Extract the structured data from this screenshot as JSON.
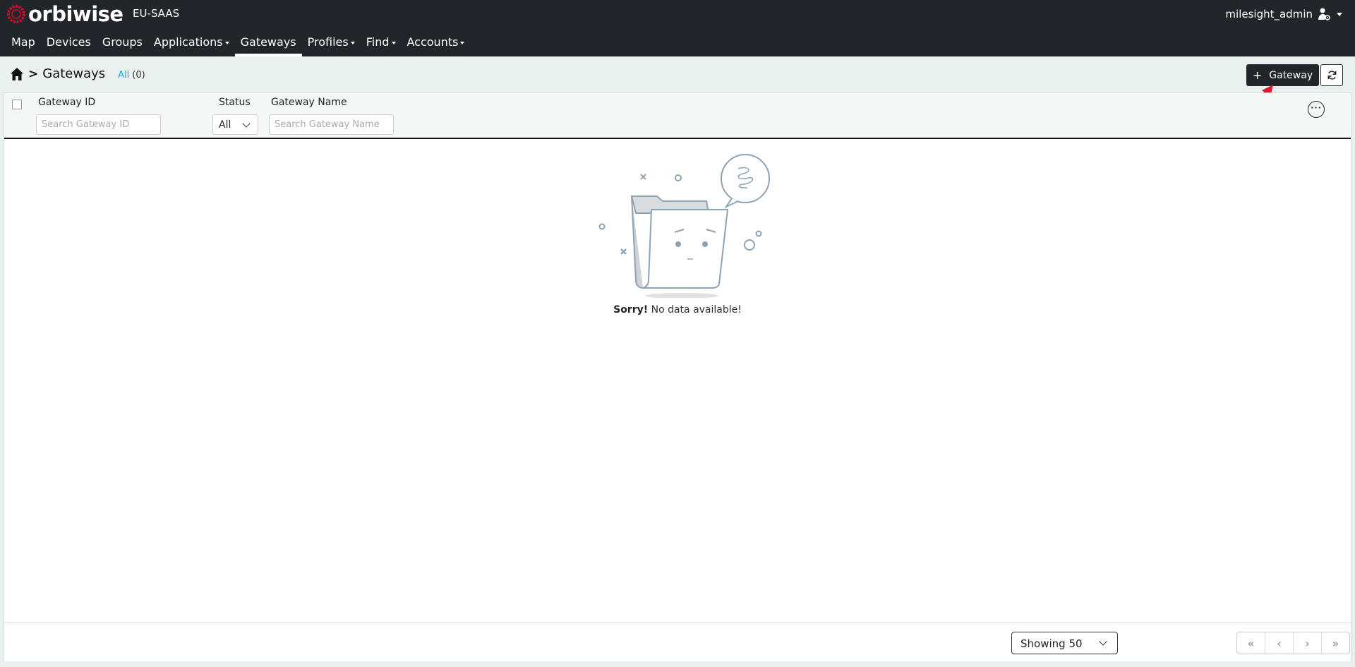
{
  "header": {
    "brand": "orbiwise",
    "environment": "EU-SAAS",
    "username": "milesight_admin",
    "colors": {
      "navbar_bg": "#22252a",
      "brand_accent": "#c8102e",
      "link": "#1aa3d6"
    }
  },
  "menu": [
    {
      "label": "Map",
      "dropdown": false
    },
    {
      "label": "Devices",
      "dropdown": false
    },
    {
      "label": "Groups",
      "dropdown": false
    },
    {
      "label": "Applications",
      "dropdown": true
    },
    {
      "label": "Gateways",
      "dropdown": false,
      "active": true
    },
    {
      "label": "Profiles",
      "dropdown": true
    },
    {
      "label": "Find",
      "dropdown": true
    },
    {
      "label": "Accounts",
      "dropdown": true
    }
  ],
  "breadcrumb": {
    "separator": ">",
    "title": "Gateways",
    "filter_all": "All",
    "count": "(0)"
  },
  "toolbar": {
    "add_plus": "+",
    "add_label": "Gateway",
    "refresh_icon": "refresh-icon"
  },
  "table": {
    "columns": {
      "gateway_id": {
        "label": "Gateway ID",
        "placeholder": "Search Gateway ID"
      },
      "status": {
        "label": "Status",
        "selected": "All"
      },
      "gateway_name": {
        "label": "Gateway Name",
        "placeholder": "Search Gateway Name"
      }
    },
    "more_icon": "···",
    "empty": {
      "bold": "Sorry!",
      "text": " No data available!"
    }
  },
  "footer": {
    "page_size": "Showing 50",
    "pager": [
      "«",
      "‹",
      "›",
      "»"
    ]
  }
}
